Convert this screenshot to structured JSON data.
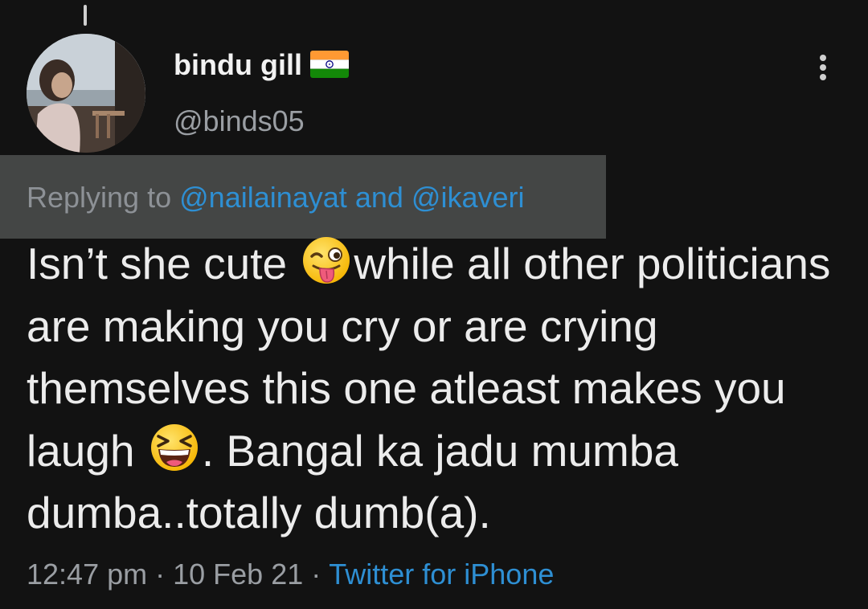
{
  "tweet": {
    "display_name": "bindu gill",
    "handle": "@binds05",
    "verified_flag_icon": "india-flag-icon",
    "more_icon": "more-vertical-icon",
    "reply": {
      "prefix": "Replying to",
      "mention_1": "@nailainayat",
      "conjunction": "and",
      "mention_2": "@ikaveri"
    },
    "text": {
      "part_1": "Isn’t she cute ",
      "emoji_1": "winking-face-with-tongue-emoji",
      "part_2": "while all other politicians are making you cry or are crying themselves this one atleast makes you laugh ",
      "emoji_2": "grinning-squinting-face-emoji",
      "part_3": ". Bangal ka jadu mumba dumba..totally dumb(a)."
    },
    "time": "12:47 pm",
    "date": "10 Feb 21",
    "separator": "·",
    "source": "Twitter for iPhone"
  },
  "colors": {
    "background": "#121212",
    "link": "#2e8fd3",
    "muted_text": "#9a9ea3",
    "reply_highlight": "#444645"
  }
}
